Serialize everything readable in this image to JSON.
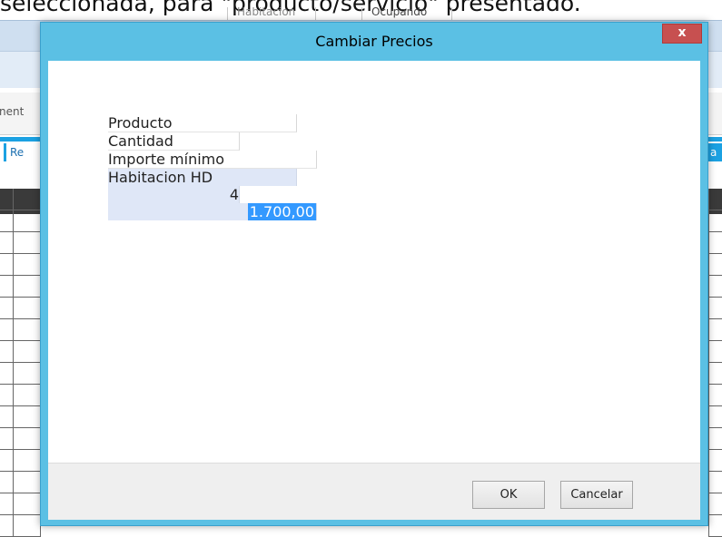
{
  "background": {
    "caption": "seleccionada, para \"producto/servicio\" presentado.",
    "header_cells": [
      "Habitacion",
      "Ocupando"
    ],
    "left_text": "nent",
    "left_tab": "Re",
    "right_tab": "a"
  },
  "dialog": {
    "title": "Cambiar Precios",
    "close_label": "x",
    "grid": {
      "columns": [
        "Producto",
        "Cantidad",
        "Importe mínimo"
      ],
      "rows": [
        {
          "producto": "Habitacion HD",
          "cantidad": "4",
          "importe": "1.700,00"
        }
      ]
    },
    "buttons": {
      "ok": "OK",
      "cancel": "Cancelar"
    }
  }
}
